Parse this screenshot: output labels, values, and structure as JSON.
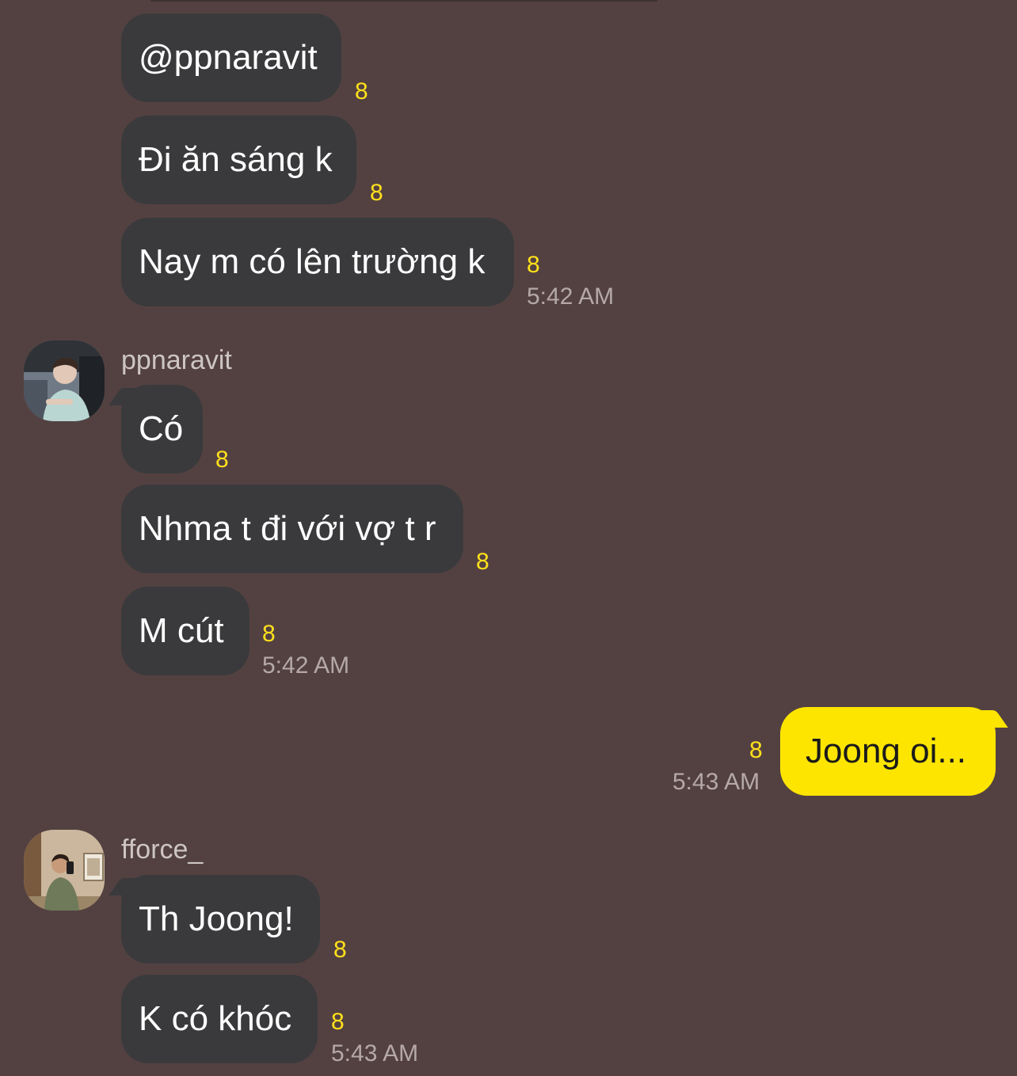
{
  "messages": [
    {
      "text": "@ppnaravit",
      "unread": "8"
    },
    {
      "text": "Đi ăn sáng k",
      "unread": "8"
    },
    {
      "text": "Nay m có lên trường k",
      "unread": "8",
      "time": "5:42 AM"
    },
    {
      "sender": "ppnaravit",
      "text": "Có",
      "unread": "8"
    },
    {
      "text": "Nhma t đi với vợ t r",
      "unread": "8"
    },
    {
      "text": "M cút",
      "unread": "8",
      "time": "5:42 AM"
    },
    {
      "text": "Joong oi...",
      "unread": "8",
      "time": "5:43 AM"
    },
    {
      "sender": "fforce_",
      "text": "Th Joong!",
      "unread": "8"
    },
    {
      "text": "K có khóc",
      "unread": "8",
      "time": "5:43 AM"
    }
  ],
  "colors": {
    "background": "#534141",
    "incoming_bubble": "#3a3a3c",
    "outgoing_bubble": "#fee500",
    "unread_count": "#ffe01b",
    "timestamp": "#b5a9a8"
  }
}
